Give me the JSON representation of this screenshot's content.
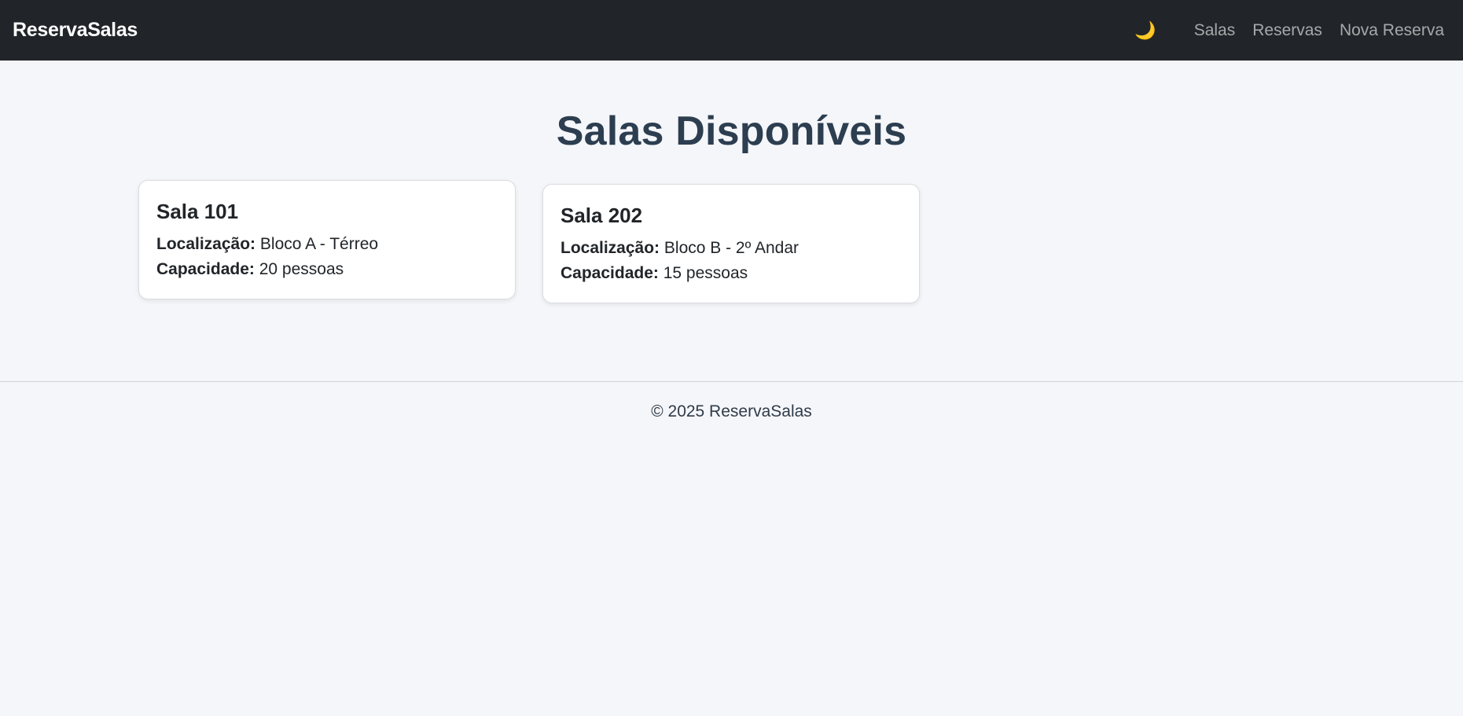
{
  "navbar": {
    "brand": "ReservaSalas",
    "theme_toggle_icon": "moon-icon",
    "theme_toggle_glyph": "🌙",
    "links": [
      "Salas",
      "Reservas",
      "Nova Reserva"
    ]
  },
  "main": {
    "title": "Salas Disponíveis",
    "rooms": [
      {
        "name": "Sala 101",
        "location_label": "Localização:",
        "location": "Bloco A - Térreo",
        "capacity_label": "Capacidade:",
        "capacity": "20 pessoas"
      },
      {
        "name": "Sala 202",
        "location_label": "Localização:",
        "location": "Bloco B - 2º Andar",
        "capacity_label": "Capacidade:",
        "capacity": "15 pessoas"
      }
    ]
  },
  "footer": {
    "text": "© 2025 ReservaSalas"
  },
  "colors": {
    "navbar_bg": "#212529",
    "page_bg": "#f5f6fa",
    "title": "#2c3e50",
    "moon": "#f2c94c"
  }
}
